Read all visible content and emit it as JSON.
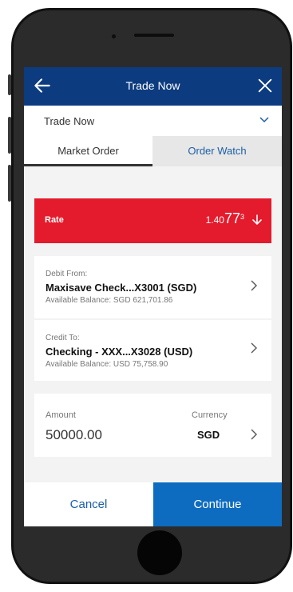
{
  "header": {
    "title": "Trade Now"
  },
  "dropdown": {
    "label": "Trade Now"
  },
  "tabs": [
    {
      "label": "Market Order",
      "active": true
    },
    {
      "label": "Order Watch",
      "active": false
    }
  ],
  "rate": {
    "label": "Rate",
    "prefix": "1.40",
    "big": "77",
    "sup": "3",
    "direction": "down",
    "color": "#e31b2c"
  },
  "debit": {
    "caption": "Debit From:",
    "account": "Maxisave Check...X3001 (SGD)",
    "balance": "Available Balance: SGD 621,701.86"
  },
  "credit": {
    "caption": "Credit To:",
    "account": "Checking - XXX...X3028 (USD)",
    "balance": "Available Balance: USD 75,758.90"
  },
  "amount": {
    "label": "Amount",
    "value": "50000.00",
    "currency_label": "Currency",
    "currency": "SGD"
  },
  "footer": {
    "cancel": "Cancel",
    "continue": "Continue"
  },
  "colors": {
    "brand": "#0c3b80",
    "accent": "#0d6cc0",
    "alert": "#e31b2c"
  }
}
